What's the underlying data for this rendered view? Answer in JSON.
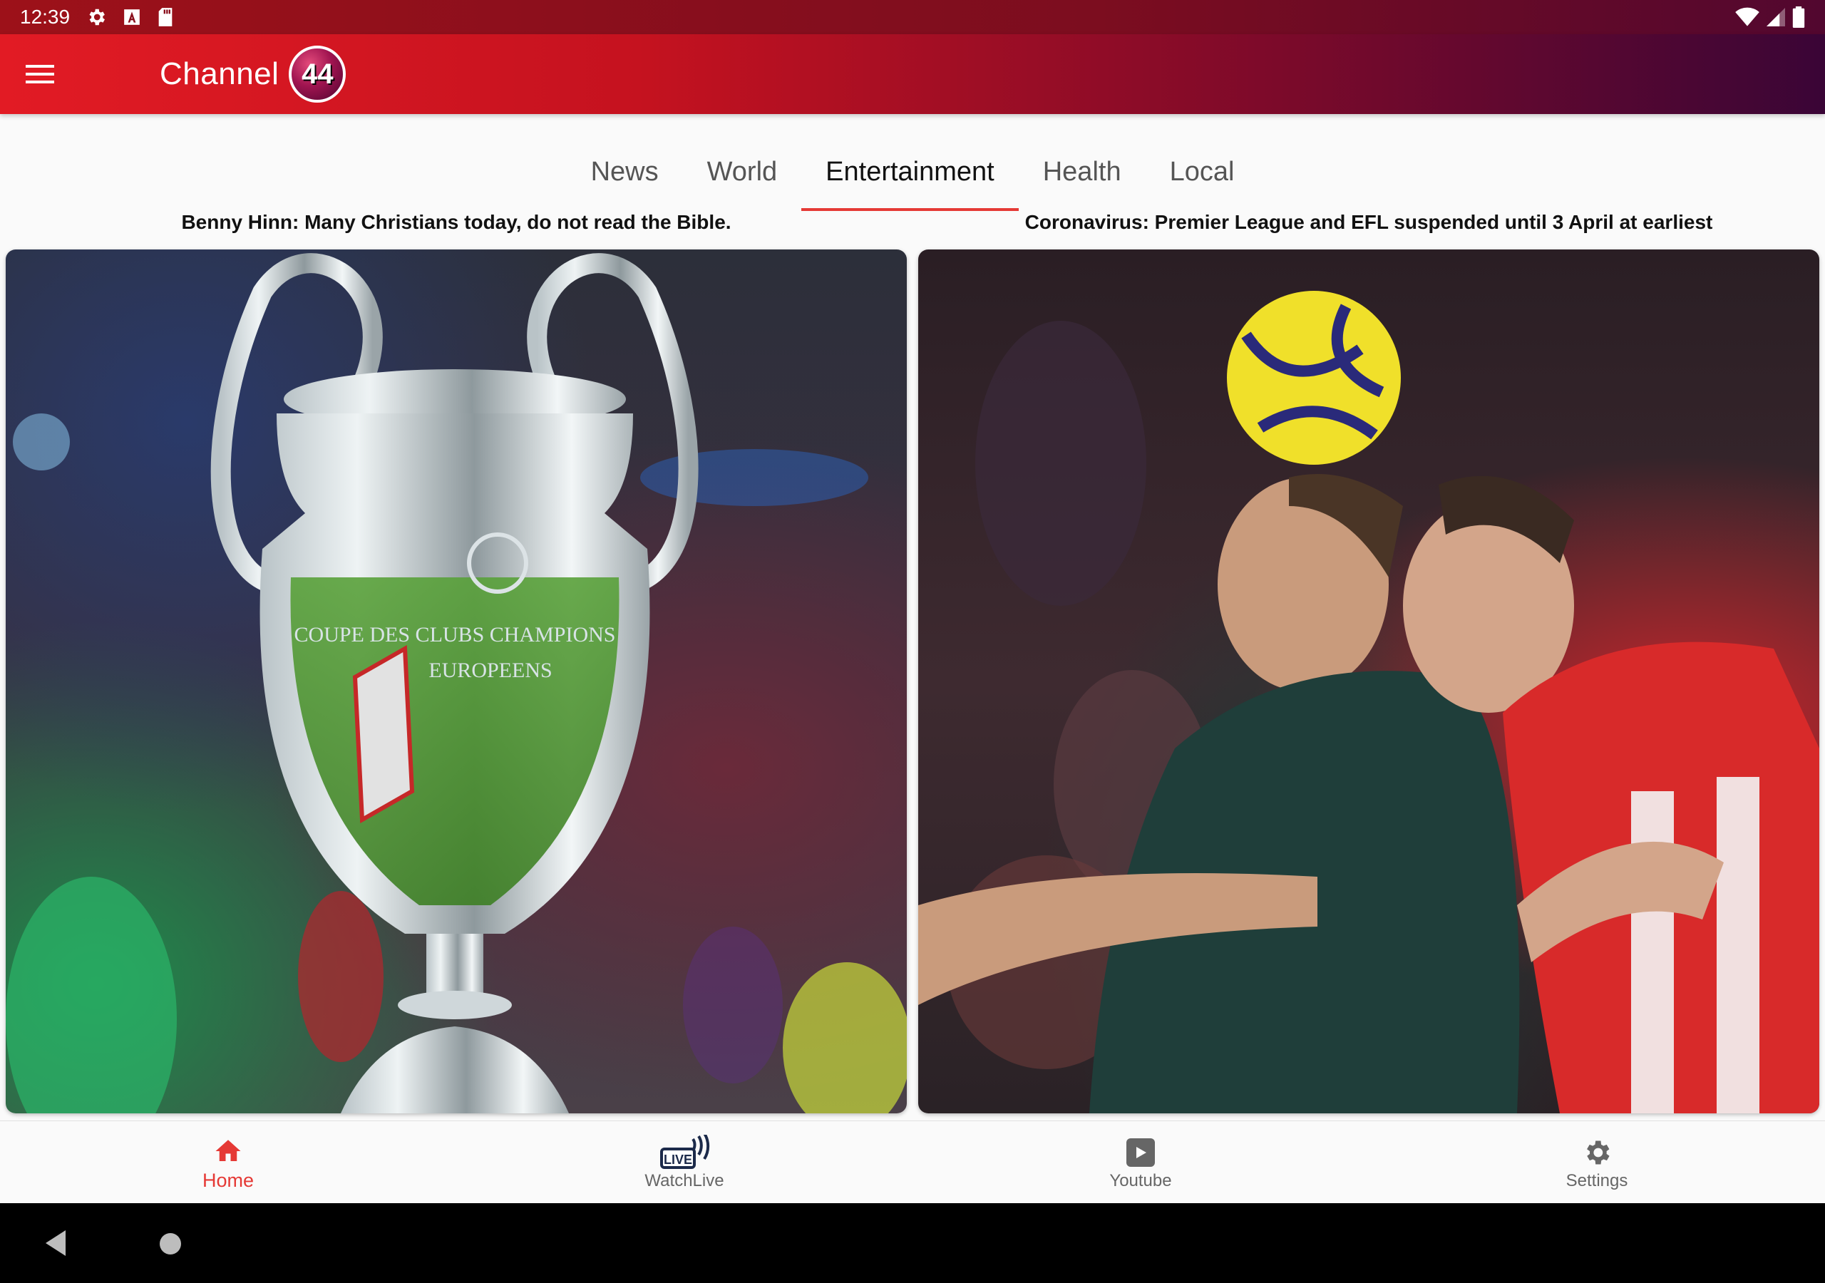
{
  "status_bar": {
    "time": "12:39",
    "left_icons": [
      "gear-icon",
      "a-box-icon",
      "sd-card-icon"
    ],
    "right_icons": [
      "wifi-icon",
      "signal-icon",
      "battery-icon"
    ]
  },
  "app_bar": {
    "menu_icon": "hamburger-menu-icon",
    "title": "Channel",
    "logo_text": "44"
  },
  "tabs": [
    {
      "label": "News",
      "active": false
    },
    {
      "label": "World",
      "active": false
    },
    {
      "label": "Entertainment",
      "active": true
    },
    {
      "label": "Health",
      "active": false
    },
    {
      "label": "Local",
      "active": false
    }
  ],
  "articles": [
    {
      "headline": "Benny Hinn: Many Christians today, do not read the Bible.",
      "image": "trophy-photo"
    },
    {
      "headline": "Coronavirus: Premier League and EFL suspended until 3 April at earliest",
      "image": "football-header-photo"
    }
  ],
  "trophy_engraving": [
    "COUPE DES CLUBS CHAMPIONS",
    "EUROPEENS"
  ],
  "bottom_nav": [
    {
      "label": "Home",
      "icon": "home-icon",
      "active": true
    },
    {
      "label": "WatchLive",
      "icon": "live-broadcast-icon",
      "active": false,
      "icon_text": "LIVE"
    },
    {
      "label": "Youtube",
      "icon": "youtube-icon",
      "active": false
    },
    {
      "label": "Settings",
      "icon": "settings-gear-icon",
      "active": false
    }
  ],
  "colors": {
    "accent": "#e53935",
    "app_bar_start": "#e21b24",
    "app_bar_end": "#3a0536"
  }
}
